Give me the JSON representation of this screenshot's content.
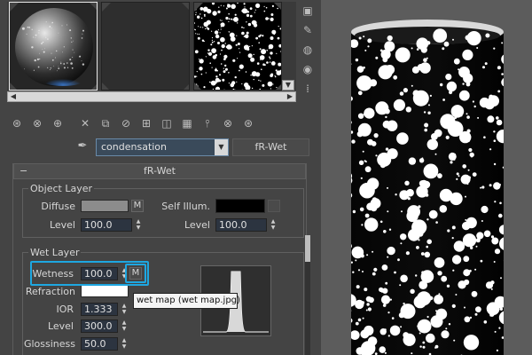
{
  "slots": {
    "items": [
      {
        "name": "sphere-preview-slot",
        "selected": true
      },
      {
        "name": "empty-slot",
        "selected": false
      },
      {
        "name": "speckle-map-slot",
        "selected": false
      }
    ]
  },
  "toolbar": {
    "icons": [
      "get-material-icon",
      "put-material-icon",
      "assign-material-icon",
      "reset-icon",
      "make-copy-icon",
      "make-unique-icon",
      "put-library-icon",
      "material-id-icon",
      "show-map-icon",
      "show-end-result-icon",
      "go-to-parent-icon",
      "go-forward-icon"
    ]
  },
  "side_tools": {
    "icons": [
      "sample-type-icon",
      "backlight-icon",
      "background-icon",
      "uv-tiling-icon",
      "video-check-icon"
    ]
  },
  "material": {
    "name": "condensation",
    "type": "fR-Wet"
  },
  "rollout": {
    "minus": "−",
    "title": "fR-Wet",
    "object_layer": {
      "title": "Object Layer",
      "diffuse_label": "Diffuse",
      "diffuse_color": "#8c8c8c",
      "diffuse_map_button": "M",
      "self_illum_label": "Self Illum.",
      "self_illum_color": "#000000",
      "level_label": "Level",
      "level_value": "100.0",
      "level2_label": "Level",
      "level2_value": "100.0"
    },
    "wet_layer": {
      "title": "Wet Layer",
      "wetness_label": "Wetness",
      "wetness_value": "100.0",
      "wetness_map_button": "M",
      "refraction_label": "Refraction",
      "refraction_color": "#ffffff",
      "ior_label": "IOR",
      "ior_value": "1.333",
      "level_label": "Level",
      "level_value": "300.0",
      "glossiness_label": "Glossiness",
      "glossiness_value": "50.0"
    },
    "tooltip": "wet map (wet map.jpg)"
  },
  "colors": {
    "highlight": "#1ea7e1",
    "panel_bg": "#444444"
  }
}
